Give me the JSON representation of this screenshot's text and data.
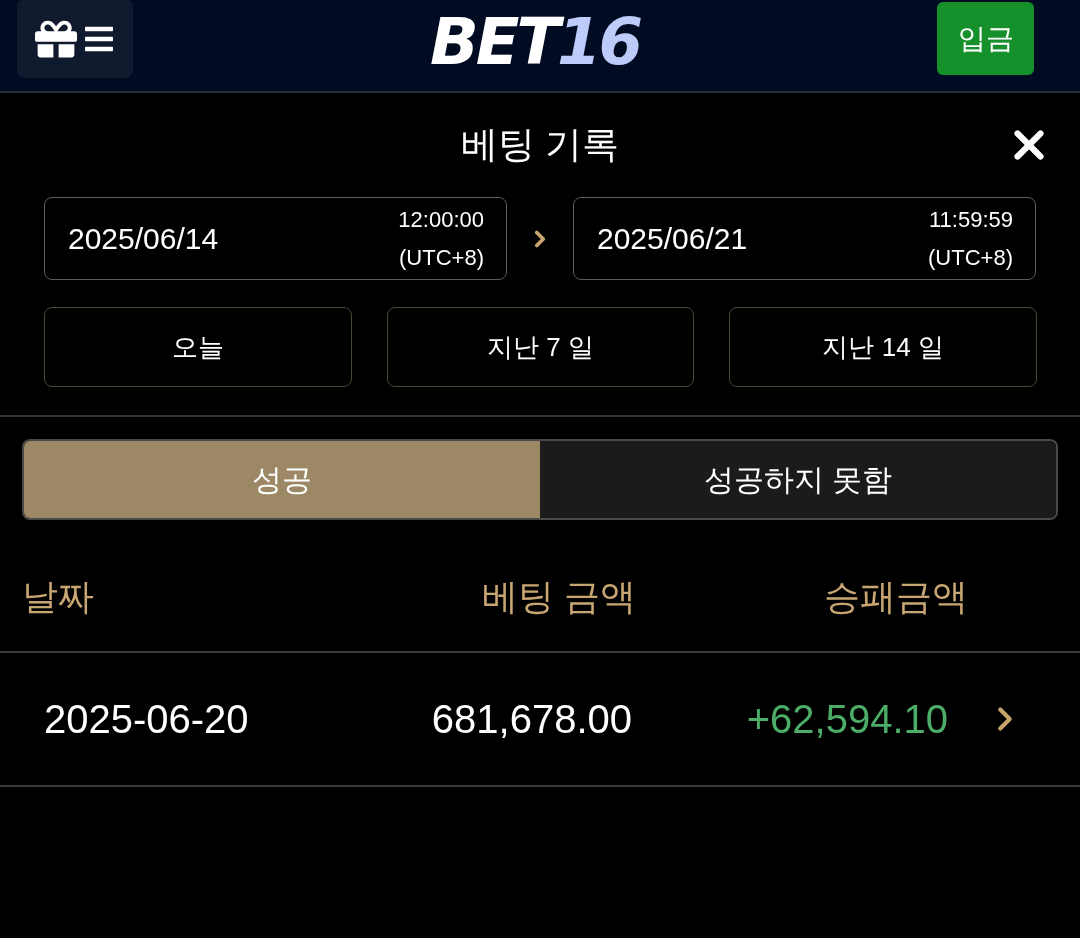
{
  "header": {
    "logo": {
      "main": "BET",
      "accent": "16"
    },
    "deposit_button": "입금"
  },
  "dialog": {
    "title": "베팅 기록",
    "date_range": {
      "start": {
        "date": "2025/06/14",
        "time": "12:00:00",
        "timezone": "(UTC+8)"
      },
      "end": {
        "date": "2025/06/21",
        "time": "11:59:59",
        "timezone": "(UTC+8)"
      }
    },
    "quick_ranges": [
      "오늘",
      "지난 7 일",
      "지난 14 일"
    ],
    "tabs": [
      {
        "label": "성공",
        "selected": true
      },
      {
        "label": "성공하지 못함",
        "selected": false
      }
    ],
    "table": {
      "columns": [
        "날짜",
        "베팅 금액",
        "승패금액"
      ],
      "rows": [
        {
          "date": "2025-06-20",
          "bet_amount": "681,678.00",
          "result_amount": "+62,594.10",
          "kind": "win"
        }
      ]
    }
  }
}
